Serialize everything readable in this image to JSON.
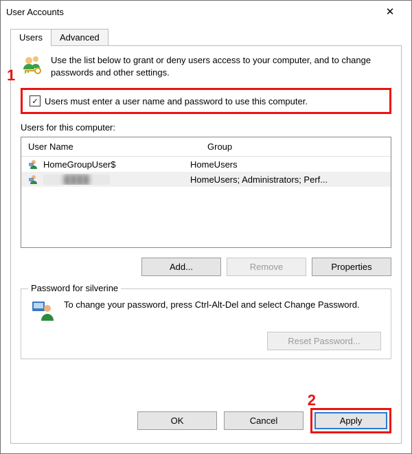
{
  "window": {
    "title": "User Accounts"
  },
  "tabs": {
    "users": "Users",
    "advanced": "Advanced"
  },
  "intro": "Use the list below to grant or deny users access to your computer, and to change passwords and other settings.",
  "checkbox": {
    "label": "Users must enter a user name and password to use this computer.",
    "checked": "✓"
  },
  "list": {
    "section_label": "Users for this computer:",
    "headers": {
      "name": "User Name",
      "group": "Group"
    },
    "rows": [
      {
        "name": "HomeGroupUser$",
        "group": "HomeUsers"
      },
      {
        "name": "████",
        "group": "HomeUsers; Administrators; Perf..."
      }
    ]
  },
  "buttons": {
    "add": "Add...",
    "remove": "Remove",
    "properties": "Properties",
    "reset_password": "Reset Password...",
    "ok": "OK",
    "cancel": "Cancel",
    "apply": "Apply"
  },
  "password_group": {
    "legend": "Password for silverine",
    "text": "To change your password, press Ctrl-Alt-Del and select Change Password."
  },
  "annotations": {
    "one": "1",
    "two": "2"
  }
}
